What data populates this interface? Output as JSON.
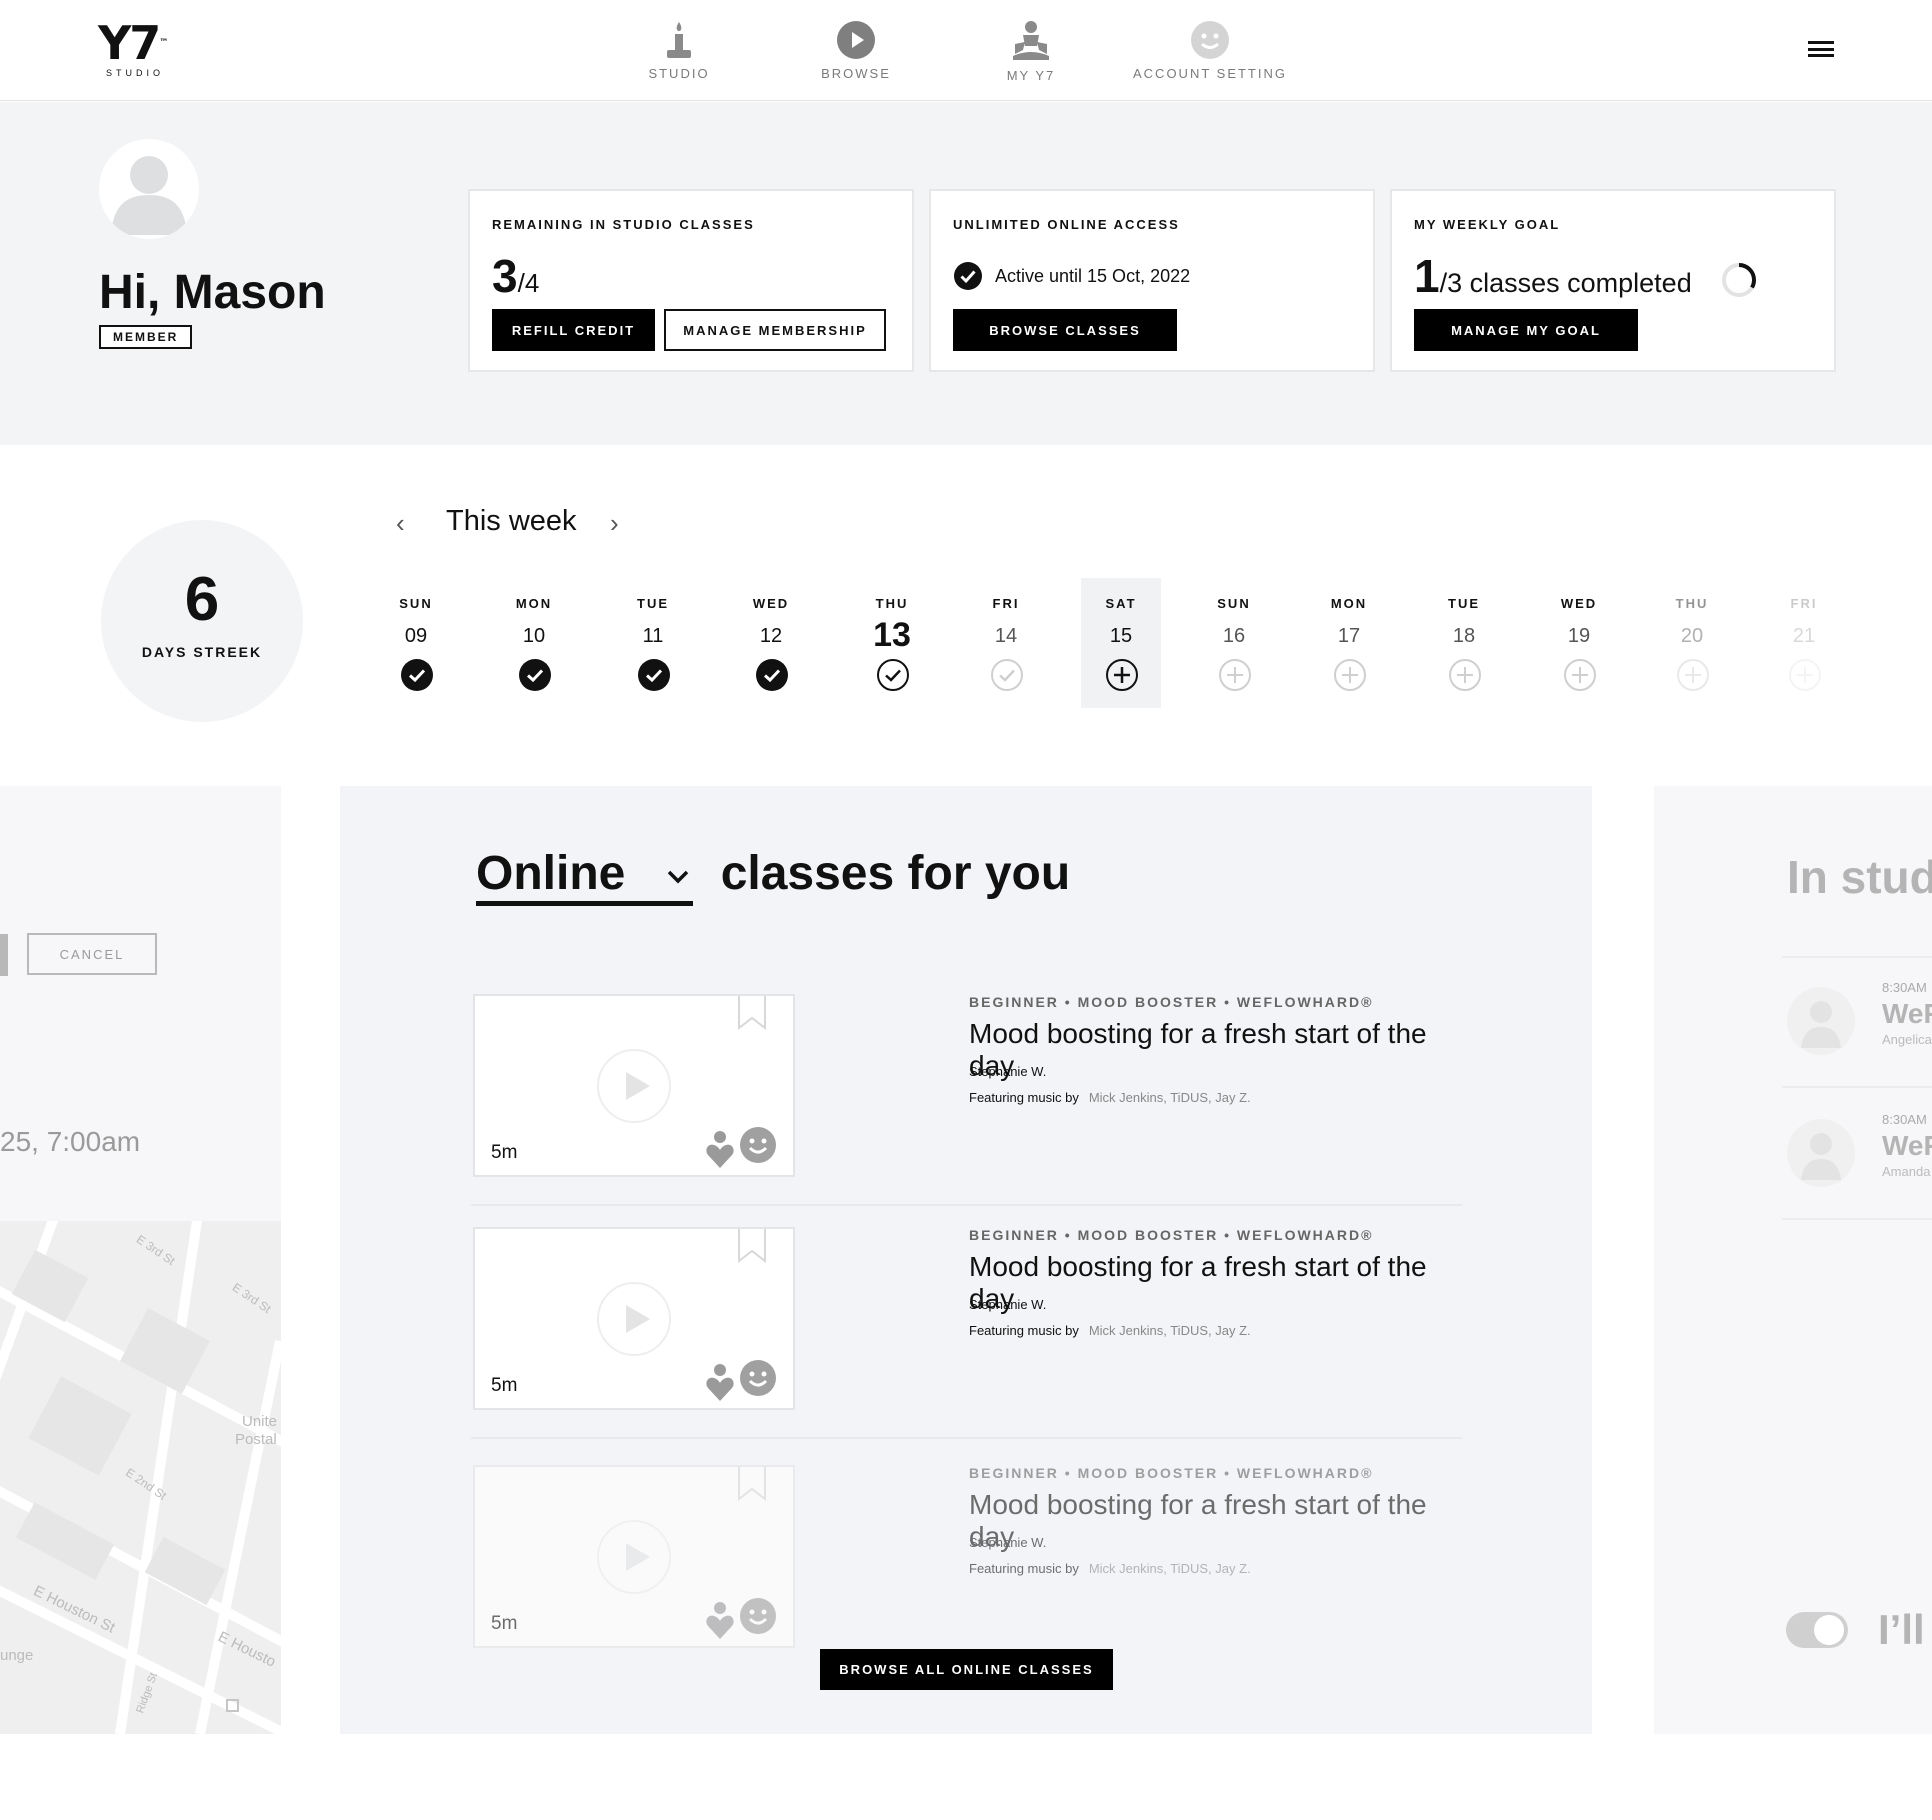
{
  "brand": {
    "logo": "Y7",
    "tm": "™",
    "sub": "STUDIO"
  },
  "nav": [
    {
      "label": "STUDIO",
      "icon": "candle-icon"
    },
    {
      "label": "BROWSE",
      "icon": "play-circle-icon"
    },
    {
      "label": "MY Y7",
      "icon": "meditation-icon"
    },
    {
      "label": "ACCOUNT SETTING",
      "icon": "smiley-icon"
    }
  ],
  "user": {
    "greeting": "Hi, Mason",
    "badge": "MEMBER"
  },
  "cards": {
    "studio": {
      "title": "REMAINING IN STUDIO CLASSES",
      "count": "3",
      "total": "/4",
      "btn_refill": "REFILL CREDIT",
      "btn_manage": "MANAGE MEMBERSHIP"
    },
    "online": {
      "title": "UNLIMITED ONLINE ACCESS",
      "status": "Active until 15 Oct, 2022",
      "btn": "BROWSE CLASSES"
    },
    "goal": {
      "title": "MY WEEKLY GOAL",
      "count": "1",
      "text": "/3 classes completed",
      "progress": 0.3333,
      "btn": "MANAGE MY GOAL"
    }
  },
  "streak": {
    "value": "6",
    "label": "DAYS STREEK"
  },
  "week": {
    "title": "This week",
    "days": [
      {
        "name": "SUN",
        "num": "09",
        "state": "done"
      },
      {
        "name": "MON",
        "num": "10",
        "state": "done"
      },
      {
        "name": "TUE",
        "num": "11",
        "state": "done"
      },
      {
        "name": "WED",
        "num": "12",
        "state": "done"
      },
      {
        "name": "THU",
        "num": "13",
        "state": "today"
      },
      {
        "name": "FRI",
        "num": "14",
        "state": "pending"
      },
      {
        "name": "SAT",
        "num": "15",
        "state": "add-selected"
      },
      {
        "name": "SUN",
        "num": "16",
        "state": "add"
      },
      {
        "name": "MON",
        "num": "17",
        "state": "add"
      },
      {
        "name": "TUE",
        "num": "18",
        "state": "add"
      },
      {
        "name": "WED",
        "num": "19",
        "state": "add"
      },
      {
        "name": "THU",
        "num": "20",
        "state": "add-faint"
      },
      {
        "name": "FRI",
        "num": "21",
        "state": "add-faintest"
      }
    ]
  },
  "left_panel": {
    "cancel": "CANCEL",
    "time": "25, 7:00am",
    "map_labels": [
      "E 3rd St",
      "E 3rd St",
      "Unite",
      "Postal",
      "E 2nd St",
      "E Houston St",
      "E Housto",
      "unge",
      "Ridge St"
    ]
  },
  "online": {
    "filter": "Online",
    "title_rest": "classes for you",
    "classes": [
      {
        "meta": "BEGINNER • MOOD BOOSTER • WEFLOWHARD®",
        "title": "Mood boosting for a fresh start of the day",
        "instructor": "Stephanie W.",
        "music_label": "Featuring music by",
        "music": "Mick Jenkins, TiDUS, Jay Z.",
        "duration": "5m"
      },
      {
        "meta": "BEGINNER • MOOD BOOSTER • WEFLOWHARD®",
        "title": "Mood boosting for a fresh start of the day",
        "instructor": "Stephanie W.",
        "music_label": "Featuring music by",
        "music": "Mick Jenkins, TiDUS, Jay Z.",
        "duration": "5m"
      },
      {
        "meta": "BEGINNER • MOOD BOOSTER • WEFLOWHARD®",
        "title": "Mood boosting for a fresh start of the day",
        "instructor": "Stephanie W.",
        "music_label": "Featuring music by",
        "music": "Mick Jenkins, TiDUS, Jay Z.",
        "duration": "5m"
      }
    ],
    "browse_all": "BROWSE ALL ONLINE CLASSES"
  },
  "right_panel": {
    "title": "In stud",
    "items": [
      {
        "time": "8:30AM",
        "title": "WeF",
        "instructor": "Angelica"
      },
      {
        "time": "8:30AM",
        "title": "WeF",
        "instructor": "Amanda"
      }
    ],
    "toggle_label": "I’ll"
  }
}
